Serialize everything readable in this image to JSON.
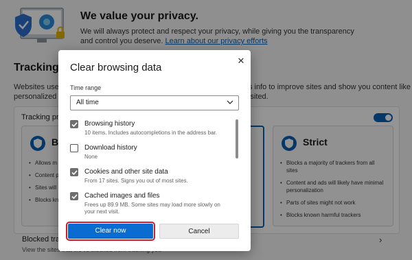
{
  "hero": {
    "title": "We value your privacy.",
    "text_line1": "We will always protect and respect your privacy, while giving you the transparency",
    "text_line2_prefix": "and control you deserve. ",
    "link": "Learn about our privacy efforts"
  },
  "tracking": {
    "title": "Tracking p",
    "desc_left_1": "Websites use t",
    "desc_left_2": "personalized a",
    "desc_right_1": "s info to improve sites and show you content like",
    "desc_right_2": "isited.",
    "panel_label": "Tracking pre",
    "cards": {
      "basic": {
        "name": "Ba",
        "bullets": [
          "Allows m",
          "Content personali",
          "Sites will",
          "Blocks kn"
        ]
      },
      "strict": {
        "name": "Strict",
        "bullets": [
          "Blocks a majority of trackers from all sites",
          "Content and ads will likely have minimal personalization",
          "Parts of sites might not work",
          "Blocks known harmful trackers"
        ]
      }
    },
    "blocked_title": "Blocked trac",
    "blocked_sub": "View the sites that we've blocked from tracking you"
  },
  "dialog": {
    "title": "Clear browsing data",
    "time_range_label": "Time range",
    "time_range_value": "All time",
    "items": [
      {
        "title": "Browsing history",
        "desc": "10 items. Includes autocompletions in the address bar.",
        "checked": true
      },
      {
        "title": "Download history",
        "desc": "None",
        "checked": false
      },
      {
        "title": "Cookies and other site data",
        "desc": "From 17 sites. Signs you out of most sites.",
        "checked": true
      },
      {
        "title": "Cached images and files",
        "desc": "Frees up 89.9 MB. Some sites may load more slowly on your next visit.",
        "checked": true
      }
    ],
    "clear_button": "Clear now",
    "cancel_button": "Cancel"
  },
  "colors": {
    "accent": "#0a6cd0",
    "highlight": "#d11a2a",
    "overlay": "rgba(0,0,0,0.42)"
  },
  "icons": [
    "privacy-illustration-icon",
    "shield-icon",
    "chevron-right-icon",
    "close-icon",
    "chevron-down-icon",
    "checkmark-icon"
  ]
}
